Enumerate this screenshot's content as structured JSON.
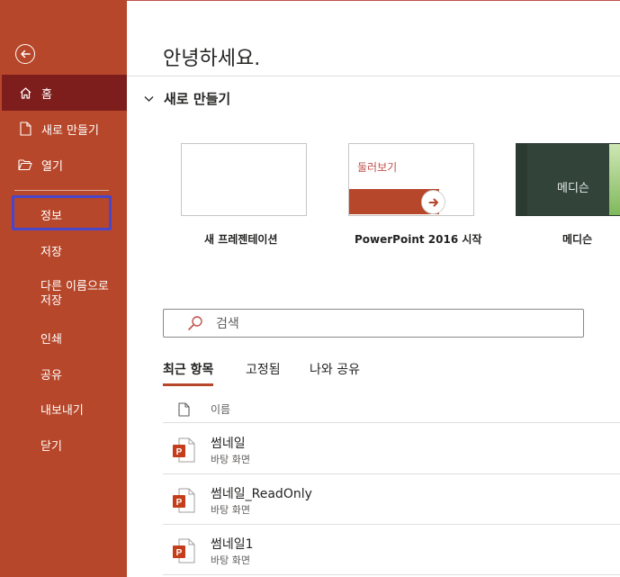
{
  "sidebar": {
    "back_icon": "back-arrow-icon",
    "items": [
      {
        "label": "홈",
        "icon": "home-icon",
        "active": true
      },
      {
        "label": "새로 만들기",
        "icon": "new-document-icon"
      },
      {
        "label": "열기",
        "icon": "folder-open-icon"
      },
      {
        "label": "정보"
      },
      {
        "label": "저장"
      },
      {
        "label": "다른 이름으로\n저장"
      },
      {
        "label": "인쇄"
      },
      {
        "label": "공유"
      },
      {
        "label": "내보내기"
      },
      {
        "label": "닫기"
      }
    ]
  },
  "main": {
    "greeting": "안녕하세요.",
    "new_section": {
      "title": "새로 만들기",
      "templates": [
        {
          "caption": "새 프레젠테이션"
        },
        {
          "caption": "PowerPoint 2016 시작",
          "thumb_text": "둘러보기"
        },
        {
          "caption": "메디슨",
          "thumb_text": "메디슨"
        }
      ]
    },
    "search": {
      "placeholder": "검색",
      "icon": "search-icon"
    },
    "tabs": [
      {
        "label": "최근 항목",
        "active": true
      },
      {
        "label": "고정됨"
      },
      {
        "label": "나와 공유"
      }
    ],
    "list": {
      "name_column": "이름",
      "files": [
        {
          "name": "썸네일",
          "location": "바탕 화면"
        },
        {
          "name": "썸네일_ReadOnly",
          "location": "바탕 화면"
        },
        {
          "name": "썸네일1",
          "location": "바탕 화면"
        }
      ]
    }
  },
  "colors": {
    "sidebar_bg": "#b7472a",
    "sidebar_active": "#7e1e1c",
    "accent": "#c0504d",
    "highlight": "#4a46c9"
  }
}
